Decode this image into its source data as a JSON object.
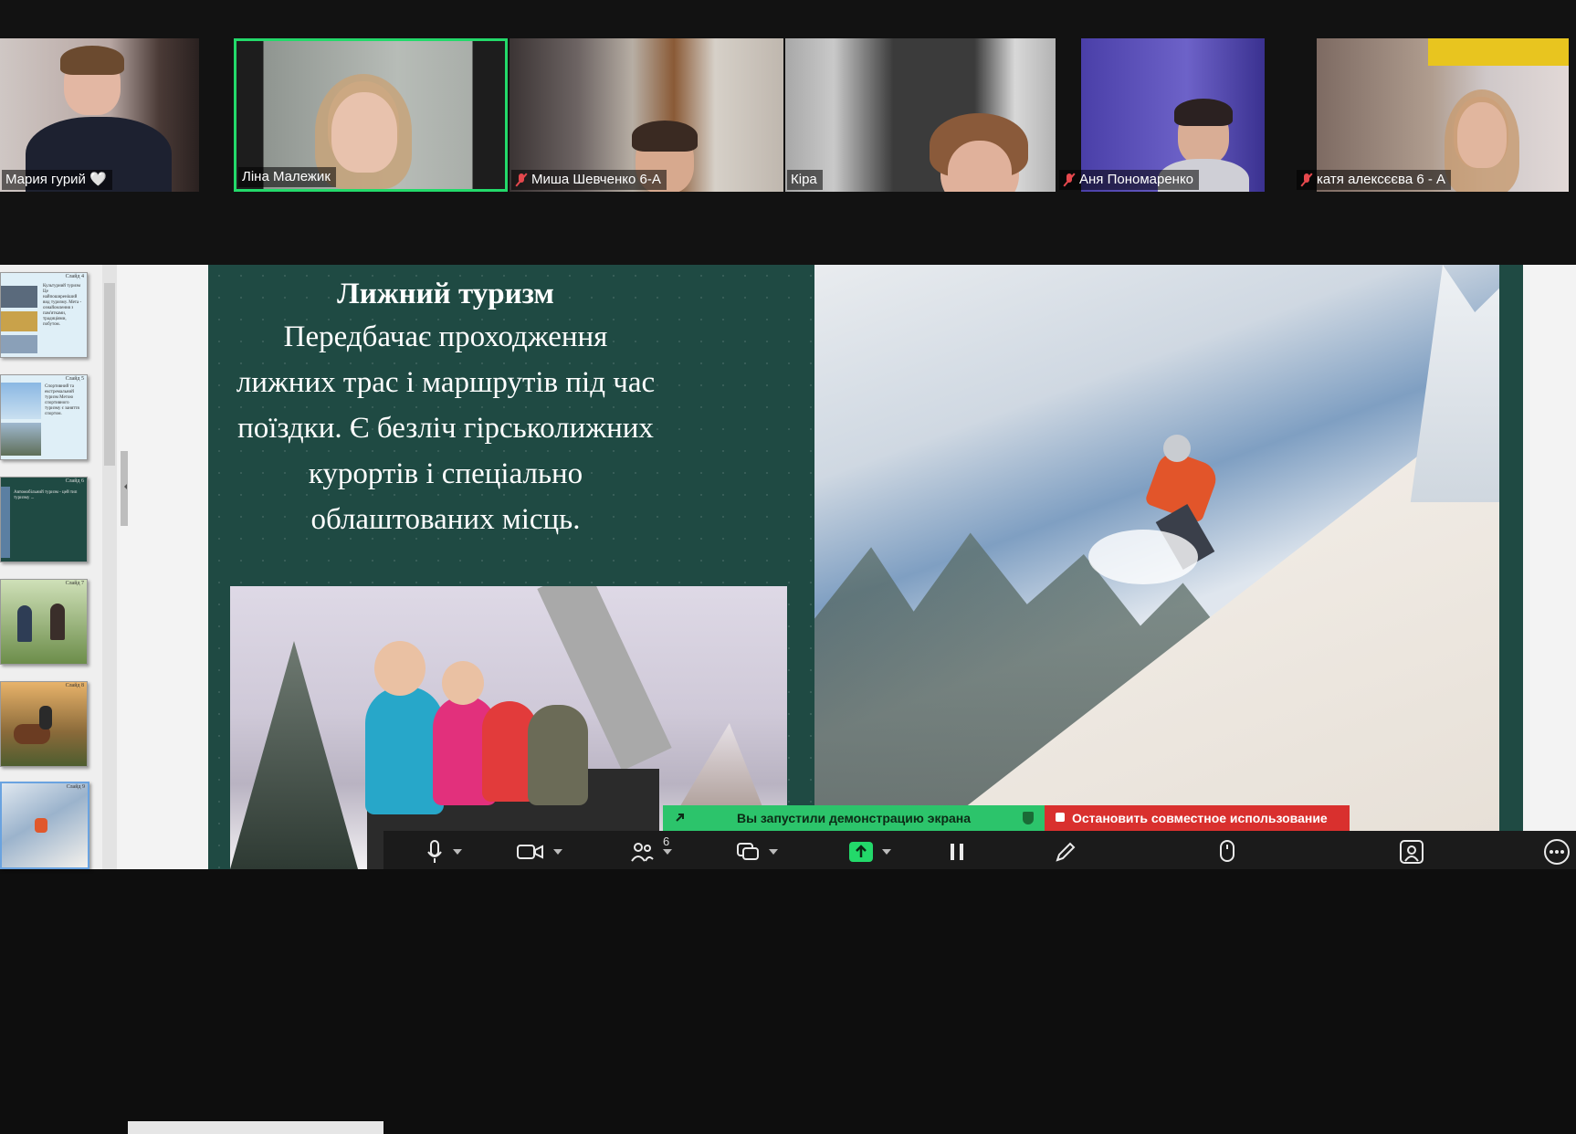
{
  "participants": [
    {
      "name": "Мария гурий 🤍",
      "muted": false,
      "active": false
    },
    {
      "name": "Ліна Малежик",
      "muted": false,
      "active": true
    },
    {
      "name": "Миша Шевченко 6-А",
      "muted": true,
      "active": false
    },
    {
      "name": "Кіра",
      "muted": false,
      "active": false
    },
    {
      "name": "Аня Пономаренко",
      "muted": true,
      "active": false
    },
    {
      "name": "катя алексєєва 6 - А",
      "muted": true,
      "active": false
    }
  ],
  "thumbnails": [
    {
      "num": "Слайд 4",
      "text": "Культурний туризм Це найпоширеніший вид туризму. Мета - ознайомлення з пам'ятками, традиціями, побутом."
    },
    {
      "num": "Слайд 5",
      "text": "Спортивний та екстремальний туризм Метою спортивного туризму є заняття спортом."
    },
    {
      "num": "Слайд 6",
      "text": "Автомобільний туризм - цей тип туризму ..."
    },
    {
      "num": "Слайд 7",
      "text": ""
    },
    {
      "num": "Слайд 8",
      "text": ""
    },
    {
      "num": "Слайд 9",
      "text": ""
    }
  ],
  "slide": {
    "title": "Лижний туризм",
    "body": "Передбачає проходження лижних трас і маршрутів під час поїздки. Є безліч гірськолижних курортів і спеціально облаштованих місць."
  },
  "banner": {
    "share_text": "Вы запустили демонстрацию экрана",
    "stop_text": "Остановить совместное использование"
  },
  "toolbar": {
    "participants_count": "6",
    "icons": [
      "microphone-icon",
      "video-camera-icon",
      "participants-icon",
      "chat-icon",
      "share-screen-icon",
      "pause-icon",
      "annotate-icon",
      "remote-control-icon",
      "apps-icon",
      "more-icon"
    ]
  },
  "colors": {
    "slide_bg": "#1f4a43",
    "active_speaker": "#23d96a",
    "share_banner": "#2cc46b",
    "stop_banner": "#d9302e"
  }
}
